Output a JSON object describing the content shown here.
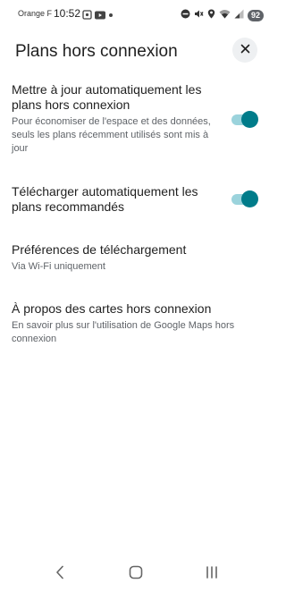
{
  "status_bar": {
    "carrier": "Orange F",
    "time": "10:52",
    "battery": "92"
  },
  "header": {
    "title": "Plans hors connexion"
  },
  "settings": [
    {
      "title": "Mettre à jour automatiquement les plans hors connexion",
      "description": "Pour économiser de l'espace et des données, seuls les plans récemment utilisés sont mis à jour",
      "toggle_on": true
    },
    {
      "title": "Télécharger automatiquement les plans recommandés",
      "toggle_on": true
    },
    {
      "title": "Préférences de téléchargement",
      "description": "Via Wi-Fi uniquement"
    },
    {
      "title": "À propos des cartes hors connexion",
      "description": "En savoir plus sur l'utilisation de Google Maps hors connexion"
    }
  ],
  "colors": {
    "toggle_thumb": "#007c8a",
    "toggle_track": "#9bd3dc",
    "text_primary": "#1f1f1f",
    "text_secondary": "#5f6368"
  },
  "icons": [
    "screenshot-icon",
    "youtube-icon",
    "dot-icon",
    "do-not-disturb-icon",
    "mute-icon",
    "location-icon",
    "wifi-icon",
    "signal-icon",
    "close-icon",
    "back-icon",
    "home-icon",
    "recents-icon"
  ]
}
